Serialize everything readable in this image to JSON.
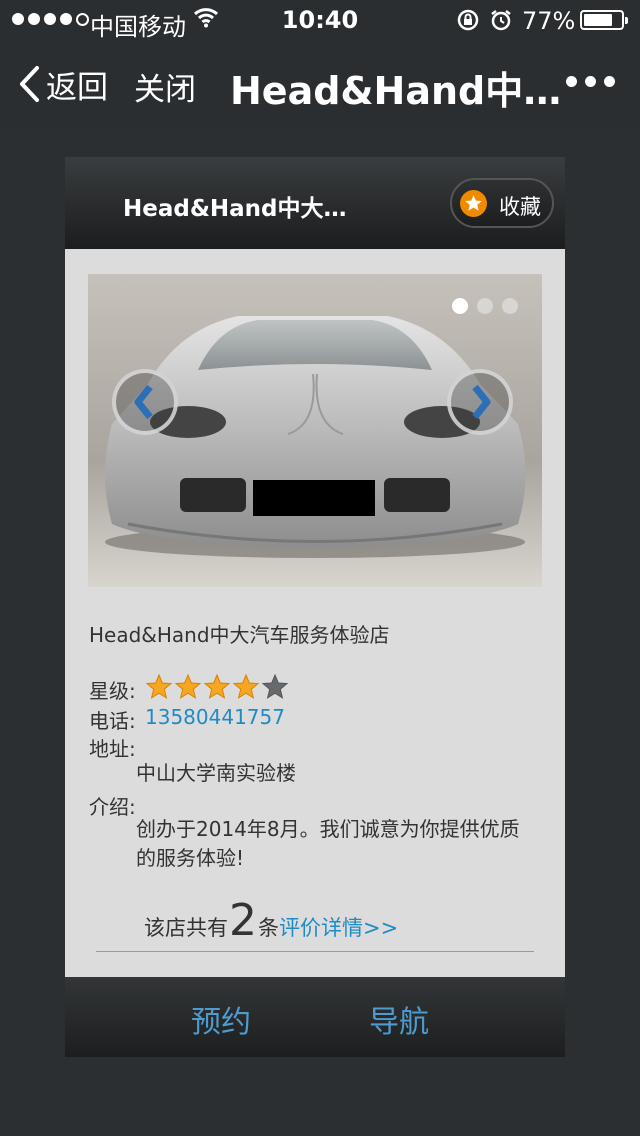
{
  "status_bar": {
    "carrier": "中国移动",
    "time": "10:40",
    "battery_percent": "77%",
    "battery_level": 0.77,
    "signal_bars_filled": 4,
    "signal_bars_total": 5
  },
  "nav": {
    "back_label": "返回",
    "close_label": "关闭",
    "title": "Head&Hand中…"
  },
  "card": {
    "header_title": "Head&Hand中大…",
    "favorite_label": "收藏",
    "carousel": {
      "slide_count": 3,
      "active_index": 0
    },
    "shop_name": "Head&Hand中大汽车服务体验店",
    "rating_label": "星级:",
    "rating": 4,
    "rating_max": 5,
    "phone_label": "电话:",
    "phone": "13580441757",
    "address_label": "地址:",
    "address": "中山大学南实验楼",
    "intro_label": "介绍:",
    "intro": "创办于2014年8月。我们诚意为你提供优质的服务体验!",
    "review_prefix": "该店共有",
    "review_count": "2",
    "review_suffix": "条",
    "review_link": "评价详情>>",
    "book_label": "预约",
    "navigate_label": "导航"
  },
  "colors": {
    "accent_link": "#1f8bc6",
    "footer_button": "#4e9bd0",
    "favorite_icon": "#f08a00",
    "star_filled": "#f5a623",
    "star_empty": "#666a6d"
  }
}
